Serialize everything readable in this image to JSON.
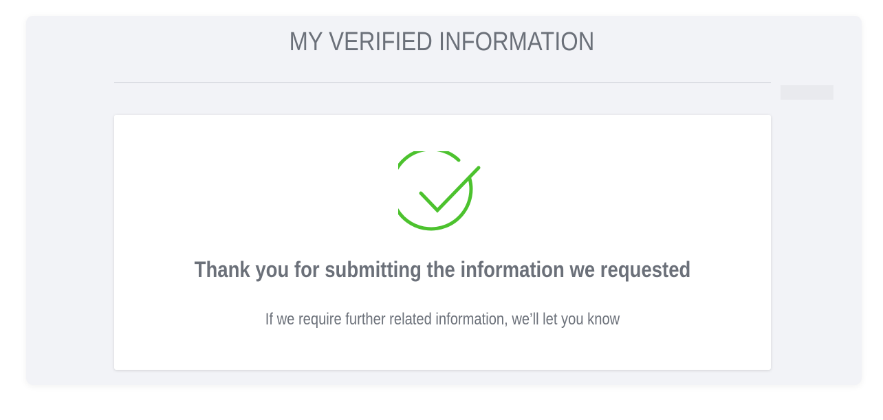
{
  "page": {
    "title": "MY VERIFIED INFORMATION"
  },
  "confirmation": {
    "icon": "check-circle-icon",
    "heading": "Thank you for submitting the information we requested",
    "message": "If we require further related information, we’ll let you know"
  },
  "colors": {
    "success": "#4cc22e",
    "text": "#6b7079",
    "panel_bg": "#f2f3f7",
    "card_bg": "#ffffff"
  }
}
